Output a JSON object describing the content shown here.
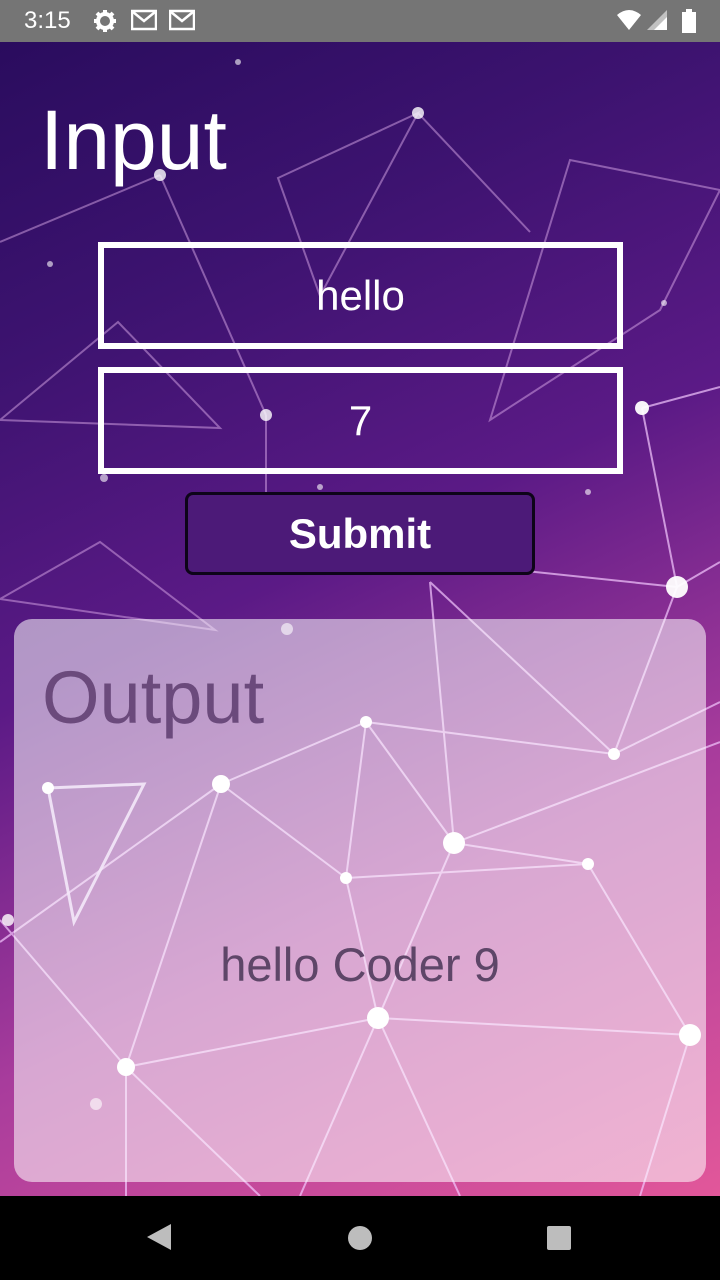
{
  "status_bar": {
    "time": "3:15",
    "icons": [
      "settings-icon",
      "gmail-icon",
      "gmail-icon",
      "wifi-icon",
      "signal-icon",
      "battery-icon"
    ]
  },
  "input_section": {
    "title": "Input",
    "text_field_value": "hello",
    "number_field_value": "7",
    "submit_label": "Submit"
  },
  "output_section": {
    "title": "Output",
    "result_text": "hello Coder 9"
  },
  "nav_bar": {
    "buttons": [
      "back-icon",
      "home-icon",
      "recents-icon"
    ]
  },
  "colors": {
    "gradient_start": "#2a0c5e",
    "gradient_end": "#e2579a",
    "submit_bg": "#4c1a78",
    "output_card": "#ffffff8c",
    "output_text": "#5e4668"
  }
}
